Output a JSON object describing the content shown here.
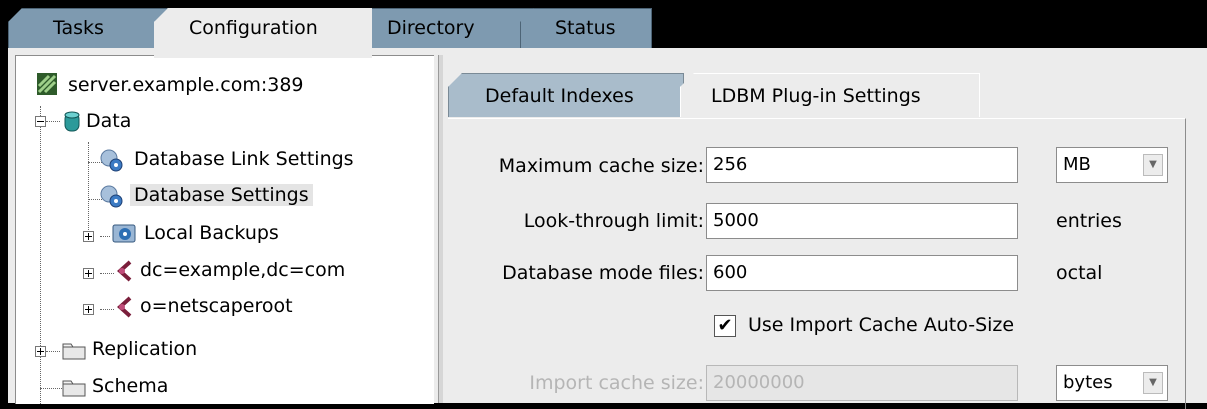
{
  "top_tabs": [
    "Tasks",
    "Configuration",
    "Directory",
    "Status"
  ],
  "active_top_tab": "Configuration",
  "tree": {
    "root": "server.example.com:389",
    "data": "Data",
    "db_link": "Database Link Settings",
    "db_settings": "Database Settings",
    "local_backups": "Local Backups",
    "suffix1": "dc=example,dc=com",
    "suffix2": "o=netscaperoot",
    "replication": "Replication",
    "schema": "Schema"
  },
  "sub_tabs": [
    "Default Indexes",
    "LDBM Plug-in Settings"
  ],
  "active_sub_tab": "LDBM Plug-in Settings",
  "form": {
    "max_cache_label": "Maximum cache size:",
    "max_cache_value": "256",
    "max_cache_unit": "MB",
    "lookthrough_label": "Look-through limit:",
    "lookthrough_value": "5000",
    "lookthrough_unit": "entries",
    "mode_label": "Database mode files:",
    "mode_value": "600",
    "mode_unit": "octal",
    "autosize_label": "Use Import Cache Auto-Size",
    "autosize_checked": true,
    "import_cache_label": "Import cache size:",
    "import_cache_value": "20000000",
    "import_cache_unit": "bytes",
    "checkmark": "✔",
    "dropdown_arrow": "▼"
  },
  "colors": {
    "tab_inactive": "#7e9ab0",
    "tab_active": "#ececec",
    "subtab_inactive": "#a9bccb",
    "panel": "#ececec"
  }
}
